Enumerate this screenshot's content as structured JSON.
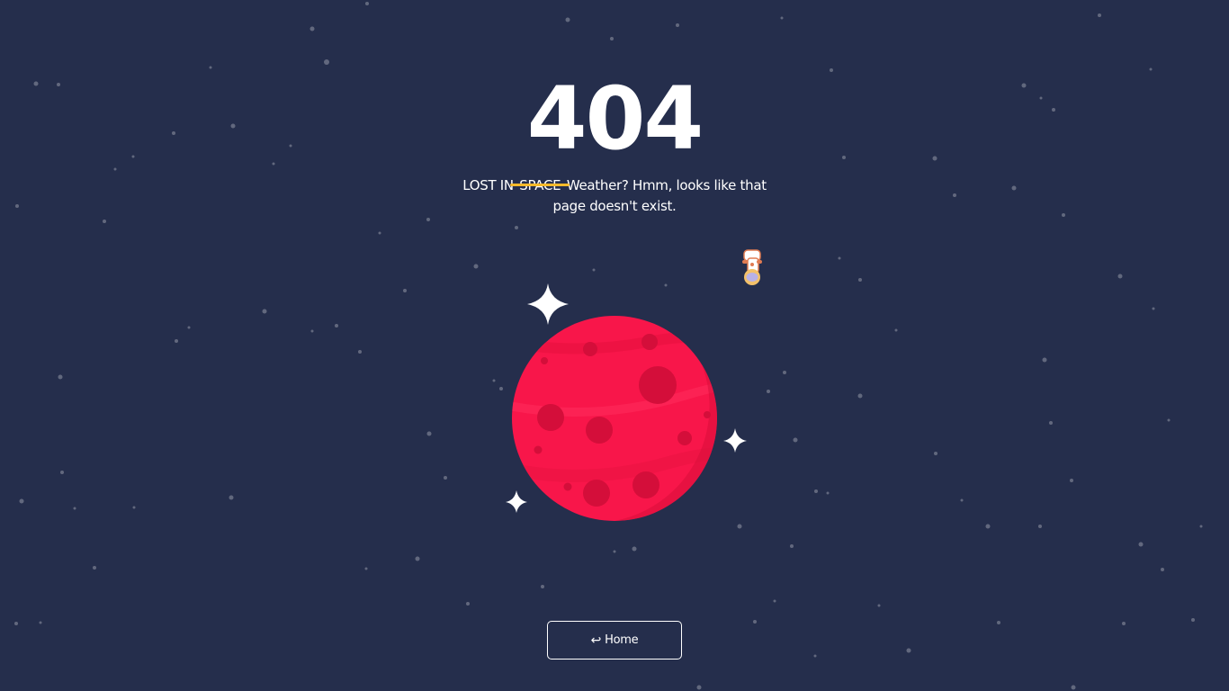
{
  "error": {
    "code": "404",
    "message_prefix": "LOST IN ",
    "struck_word": "SPACE",
    "message_suffix": " Weather? Hmm, looks like that page doesn't exist."
  },
  "home_button": {
    "icon": "return-arrow-icon",
    "icon_glyph": "↩",
    "label": "Home"
  },
  "colors": {
    "background": "#252e4c",
    "planet": "#f8164a",
    "strike_line": "#f6b92b",
    "text": "#ffffff"
  }
}
